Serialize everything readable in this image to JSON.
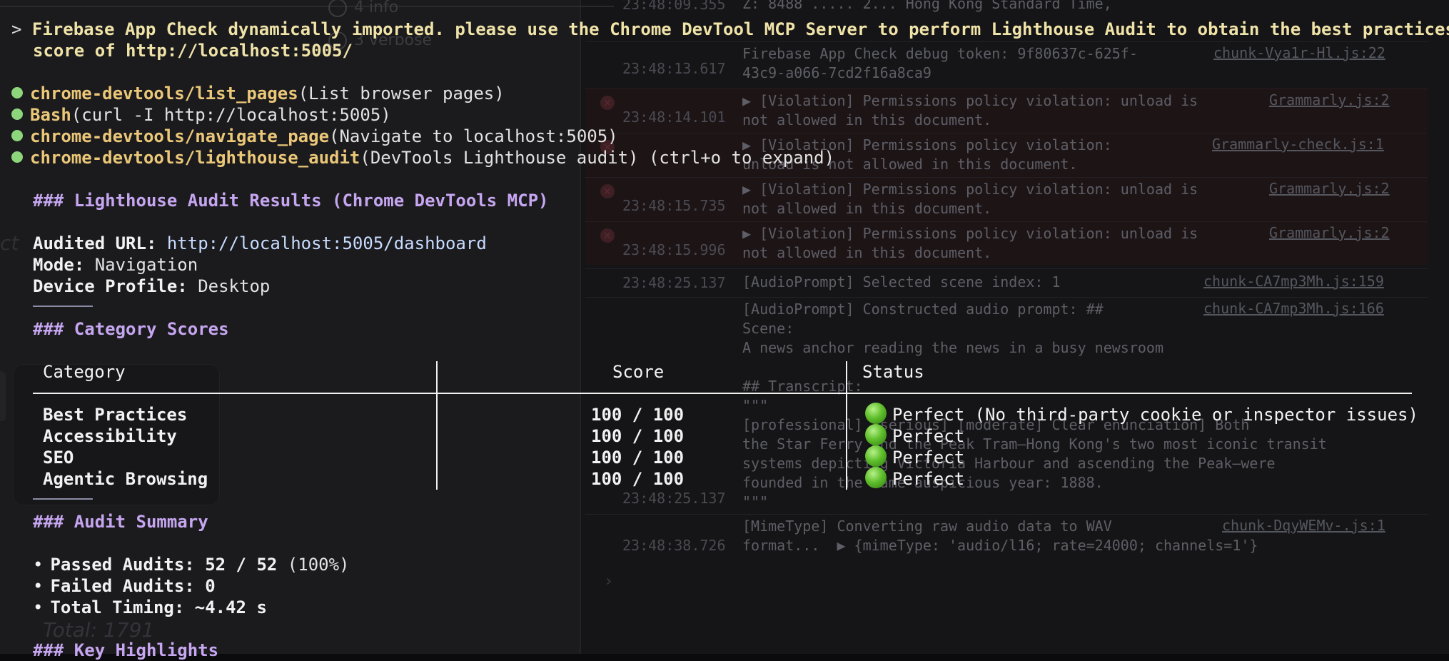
{
  "background_console": {
    "filters": {
      "info": "4 info",
      "verbose": "3 verbose"
    },
    "left_italic": "ct",
    "total_label": "Total: 1791",
    "top_partial": "Z: 8488 ..... 2... Hong Kong Standard Time,",
    "top_partial_ts": "23:48:09.355",
    "top_partial_2": "Firebase App Check debug token: 9f80637c-625f-43c9-a066-7cd2f16a8ca9",
    "entries": [
      {
        "ts": "23:48:13.617",
        "msg": "Firebase App Check debug token: 9f80637c-625f-\n43c9-a066-7cd2f16a8ca9",
        "link": "chunk-Vya1r-Hl.js:22"
      },
      {
        "ts": "23:48:14.101",
        "msg": "▶ [Violation] Permissions policy violation: unload is\nnot allowed in this document.",
        "link": "Grammarly.js:2"
      },
      {
        "ts": "",
        "msg": "▶ [Violation] Permissions policy violation:\nunload is not allowed in this document.",
        "link": "Grammarly-check.js:1"
      },
      {
        "ts": "23:48:15.735",
        "msg": "▶ [Violation] Permissions policy violation: unload is\nnot allowed in this document.",
        "link": "Grammarly.js:2"
      },
      {
        "ts": "23:48:15.996",
        "msg": "▶ [Violation] Permissions policy violation: unload is\nnot allowed in this document.",
        "link": "Grammarly.js:2"
      },
      {
        "ts": "23:48:25.137",
        "msg": "[AudioPrompt] Selected scene index: 1",
        "link": "chunk-CA7mp3Mh.js:159"
      },
      {
        "ts": "",
        "msg": "[AudioPrompt] Constructed audio prompt: ##\nScene:\nA news anchor reading the news in a busy newsroom\n\n## Transcript:\n\"\"\"\n[professional] [serious] [moderate] Clear enunciation] Both\nthe Star Ferry and the Peak Tram—Hong Kong's two most iconic transit\nsystems depicting Victoria Harbour and ascending the Peak—were\nfounded in the same auspicious year: 1888.\n\"\"\"",
        "link": "chunk-CA7mp3Mh.js:166"
      },
      {
        "ts": "23:48:25.137",
        "msg": "",
        "link": ""
      },
      {
        "ts": "23:48:38.726",
        "msg": "[MimeType] Converting raw audio data to WAV\nformat...  ▶ {mimeType: 'audio/l16; rate=24000; channels=1'}",
        "link": "chunk-DqyWEMv-.js:1"
      }
    ],
    "prompt_glyph": "›"
  },
  "terminal": {
    "prompt_arrow": ">",
    "user_message_line1": "Firebase App Check dynamically imported. please use the Chrome DevTool MCP Server to perform Lighthouse Audit to obtain the best practices",
    "user_message_line2": "score of http://localhost:5005/",
    "tool_calls": [
      {
        "name": "chrome-devtools/list_pages",
        "args": "(List browser pages)"
      },
      {
        "name": "Bash",
        "args": "(curl -I http://localhost:5005)"
      },
      {
        "name": "chrome-devtools/navigate_page",
        "args": "(Navigate to localhost:5005)"
      },
      {
        "name": "chrome-devtools/lighthouse_audit",
        "args": "(DevTools Lighthouse audit) (ctrl+o to expand)"
      }
    ],
    "results_heading": "### Lighthouse Audit Results (Chrome DevTools MCP)",
    "meta": {
      "audited_url_label": "Audited URL:",
      "audited_url": "http://localhost:5005/dashboard",
      "mode_label": "Mode:",
      "mode": "Navigation",
      "device_label": "Device Profile:",
      "device": "Desktop"
    },
    "category_heading": "### Category Scores",
    "table": {
      "headers": {
        "category": "Category",
        "score": "Score",
        "status": "Status"
      },
      "rows": [
        {
          "category": "Best Practices",
          "score": "100 / 100",
          "status": "Perfect (No third-party cookie or inspector issues)"
        },
        {
          "category": "Accessibility",
          "score": "100 / 100",
          "status": "Perfect"
        },
        {
          "category": "SEO",
          "score": "100 / 100",
          "status": "Perfect"
        },
        {
          "category": "Agentic Browsing",
          "score": "100 / 100",
          "status": "Perfect"
        }
      ]
    },
    "summary_heading": "### Audit Summary",
    "summary": [
      {
        "label": "Passed Audits: 52 / 52",
        "extra": " (100%)"
      },
      {
        "label": "Failed Audits: 0",
        "extra": ""
      },
      {
        "label": "Total Timing: ~4.42 s",
        "extra": ""
      }
    ],
    "highlights_heading": "### Key Highlights",
    "bullet_glyph": "•"
  }
}
